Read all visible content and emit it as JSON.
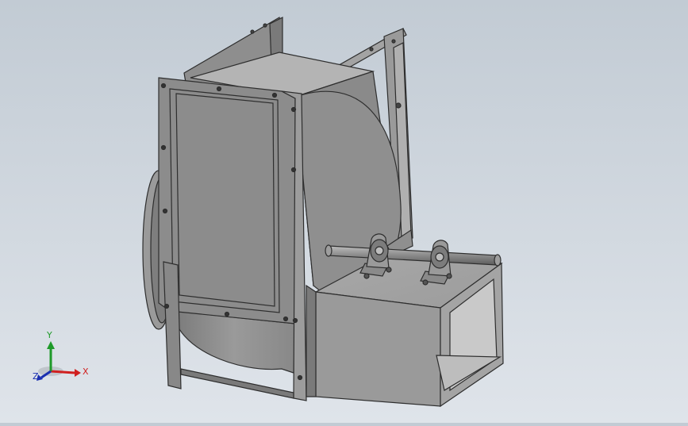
{
  "triad": {
    "x_label": "X",
    "y_label": "Y",
    "z_label": "Z",
    "colors": {
      "x": "#d02020",
      "y": "#1f9a2a",
      "z": "#1a2fb0"
    }
  },
  "model": {
    "colors": {
      "steel_light": "#a9a9a9",
      "steel_mid": "#8f8f8f",
      "steel_dark": "#6b6b6b",
      "edge": "#2e2e2e"
    }
  }
}
